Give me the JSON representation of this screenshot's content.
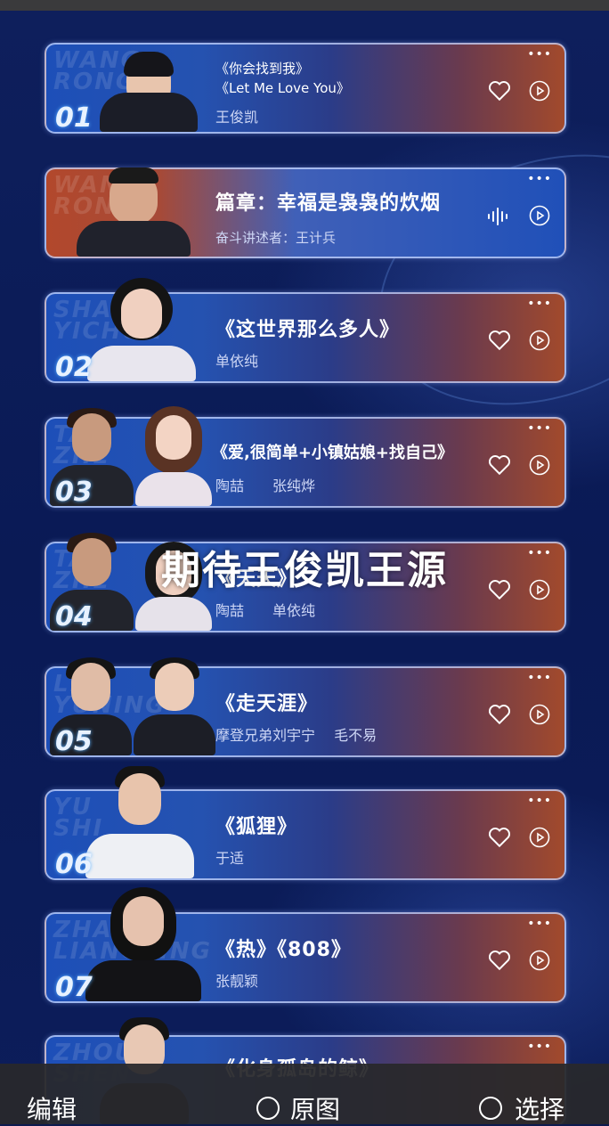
{
  "cards": [
    {
      "num": "01",
      "line1": "《你会找到我》",
      "line2": "《Let Me Love You》",
      "sub": "王俊凯",
      "style": "normal",
      "persons": 1,
      "action": "heart"
    },
    {
      "num": "",
      "line1": "篇章：幸福是袅袅的炊烟",
      "line2": "",
      "sub": "奋斗讲述者：王计兵",
      "style": "alt",
      "persons": 1,
      "action": "wave"
    },
    {
      "num": "02",
      "line1": "《这世界那么多人》",
      "line2": "",
      "sub": "单依纯",
      "style": "normal",
      "persons": 1,
      "action": "heart"
    },
    {
      "num": "03",
      "line1": "《爱,很简单+小镇姑娘+找自己》",
      "line2": "",
      "sub": "陶喆　　张纯烨",
      "style": "normal",
      "persons": 2,
      "action": "heart"
    },
    {
      "num": "04",
      "line1": "《天天》",
      "line2": "",
      "sub": "陶喆　　单依纯",
      "style": "normal",
      "persons": 2,
      "action": "heart"
    },
    {
      "num": "05",
      "line1": "《走天涯》",
      "line2": "",
      "sub": "摩登兄弟刘宇宁　 毛不易",
      "style": "normal",
      "persons": 2,
      "action": "heart"
    },
    {
      "num": "06",
      "line1": "《狐狸》",
      "line2": "",
      "sub": "于适",
      "style": "normal",
      "persons": 1,
      "action": "heart"
    },
    {
      "num": "07",
      "line1": "《热》《808》",
      "line2": "",
      "sub": "张靓颖",
      "style": "normal",
      "persons": 1,
      "action": "heart"
    },
    {
      "num": "",
      "line1": "《化身孤岛的鲸》",
      "line2": "",
      "sub": "",
      "style": "normal",
      "persons": 1,
      "action": "heart"
    }
  ],
  "overlay_text": "期待王俊凯王源",
  "bottom_bar": {
    "edit_label": "编辑",
    "original_label": "原图",
    "select_label": "选择"
  },
  "colors": {
    "background": "#0c1a4e",
    "card_border": "#c8d7ff",
    "bar_bg": "#28282c"
  }
}
